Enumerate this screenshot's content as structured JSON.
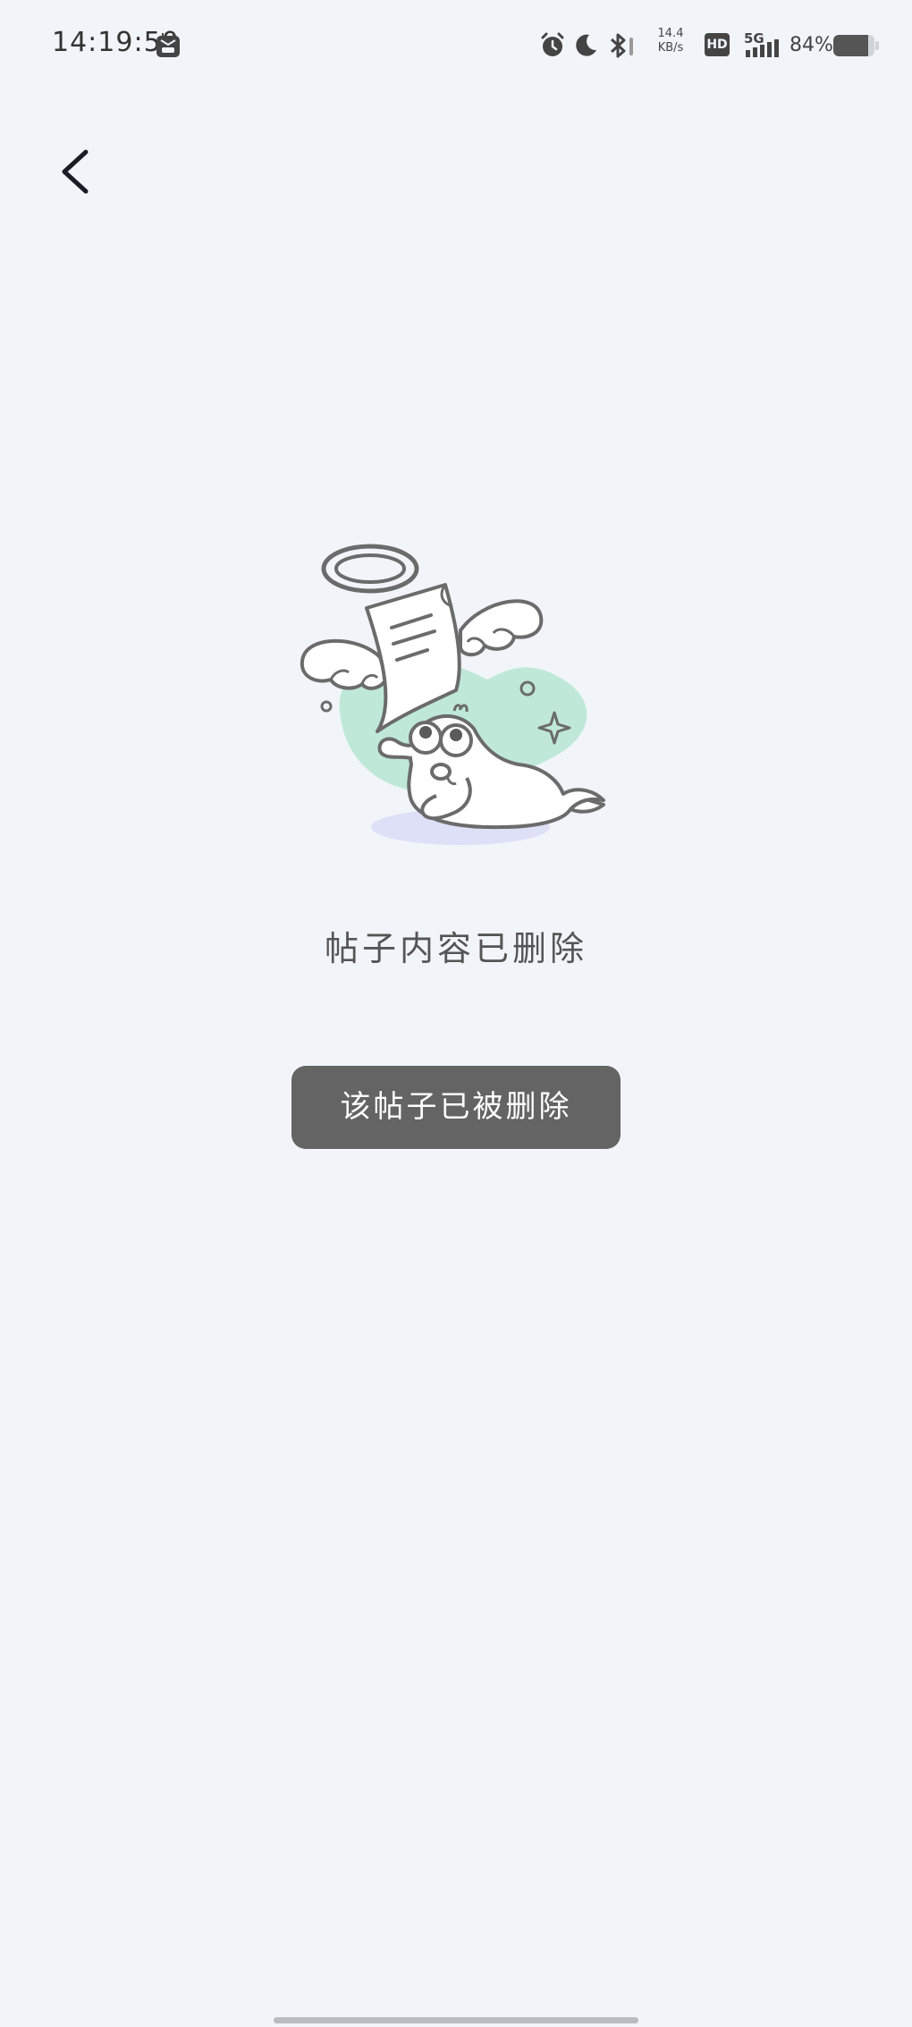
{
  "status_bar": {
    "time": "14:19:50",
    "net_speed_value": "14.4",
    "net_speed_unit": "KB/s",
    "hd_label": "HD",
    "network": "5G",
    "battery": "84%",
    "battery_level": 0.84,
    "icons": [
      "app-notification-icon",
      "alarm-icon",
      "moon-icon",
      "bluetooth-icon",
      "signal-icon",
      "battery-icon"
    ]
  },
  "header": {
    "back_icon": "back-arrow-icon"
  },
  "main": {
    "illustration": "deleted-post-angel-illustration",
    "message": "帖子内容已删除"
  },
  "toast": {
    "text": "该帖子已被删除"
  },
  "colors": {
    "background": "#f1f5f9",
    "toast_bg": "#646464",
    "accent_mint": "#bfe8d8",
    "accent_lavender": "#dde0f7"
  }
}
